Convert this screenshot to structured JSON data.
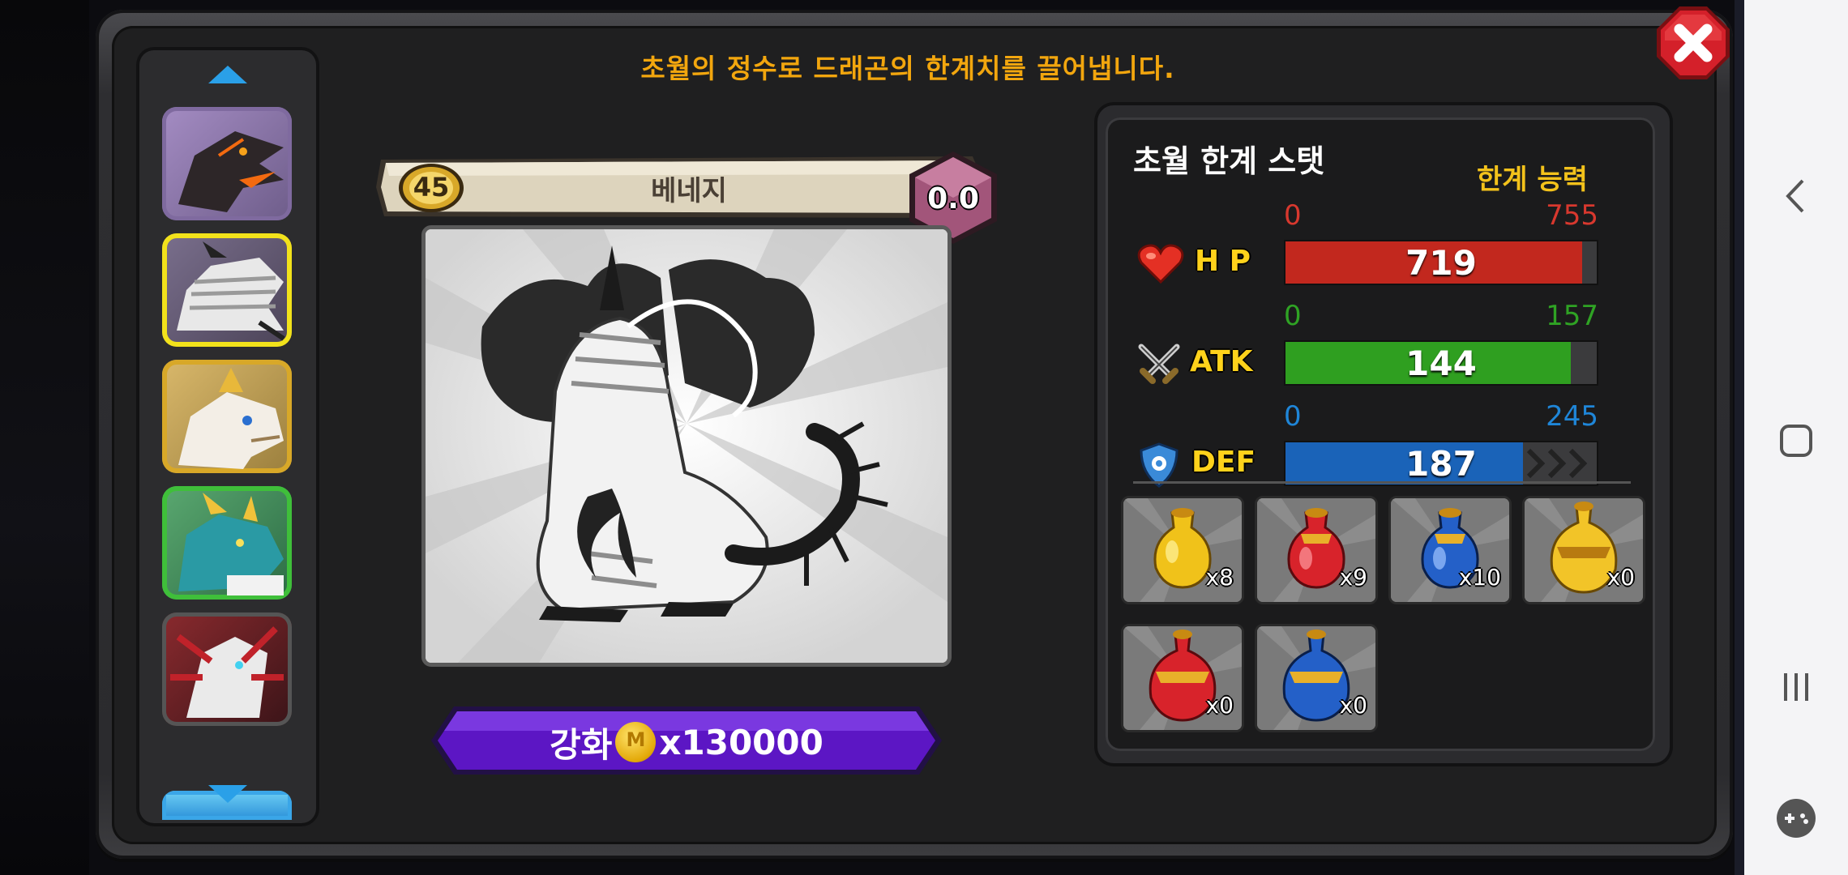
{
  "header": {
    "description": "초월의 정수로 드래곤의 한계치를 끌어냅니다."
  },
  "dragon": {
    "level": "45",
    "name": "베네지",
    "grade": "0.0"
  },
  "upgrade": {
    "label": "강화",
    "coin_symbol": "M",
    "cost": "x130000"
  },
  "stats_panel": {
    "title": "초월 한계 스탯",
    "subtitle": "한계 능력",
    "stats": [
      {
        "label": "H P",
        "min": "0",
        "max": "755",
        "value": "719",
        "fraction": 0.952,
        "color": "#c2281e",
        "min_color": "#d8382e"
      },
      {
        "label": "ATK",
        "min": "0",
        "max": "157",
        "value": "144",
        "fraction": 0.917,
        "color": "#2f9f20",
        "min_color": "#2fa324"
      },
      {
        "label": "DEF",
        "min": "0",
        "max": "245",
        "value": "187",
        "fraction": 0.763,
        "color": "#1a63b8",
        "min_color": "#1f86d8"
      }
    ]
  },
  "items": [
    {
      "name": "yellow-potion",
      "count": "x8"
    },
    {
      "name": "red-potion",
      "count": "x9"
    },
    {
      "name": "blue-potion",
      "count": "x10"
    },
    {
      "name": "gold-elixir",
      "count": "x0"
    },
    {
      "name": "red-elixir",
      "count": "x0"
    },
    {
      "name": "blue-elixir",
      "count": "x0"
    }
  ],
  "colors": {
    "headline": "#f2a60e",
    "upgrade_button": "#5c16c4",
    "close_button": "#d4202a",
    "selected_border": "#f2e21b"
  }
}
